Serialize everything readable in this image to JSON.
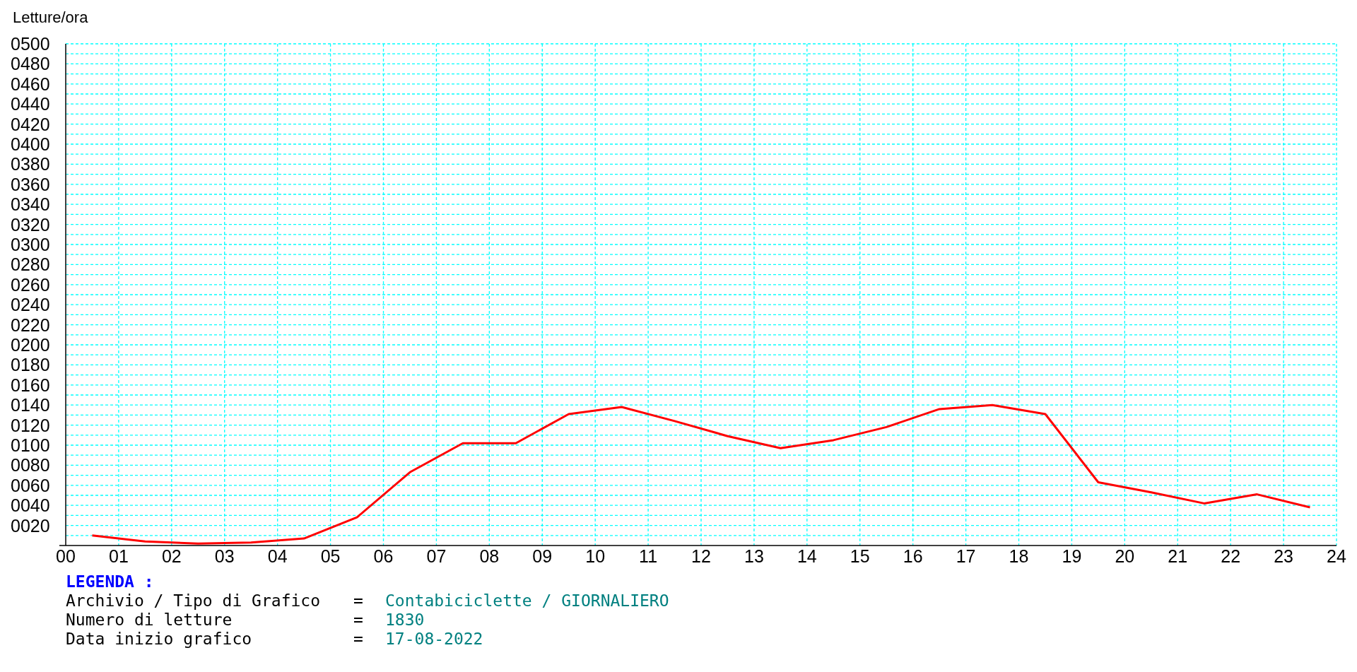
{
  "chart_data": {
    "type": "line",
    "ylabel": "Letture/ora",
    "x": [
      0.5,
      1.5,
      2.5,
      3.5,
      4.5,
      5.5,
      6.5,
      7.5,
      8.5,
      9.5,
      10.5,
      11.5,
      12.5,
      13.5,
      14.5,
      15.5,
      16.5,
      17.5,
      18.5,
      19.5,
      20.5,
      21.5,
      22.5,
      23.5
    ],
    "grid": true,
    "series": [
      {
        "color": "#ff0000",
        "values": [
          10,
          4,
          2,
          3,
          7,
          28,
          73,
          102,
          102,
          131,
          138,
          124,
          109,
          97,
          105,
          118,
          136,
          140,
          131,
          63,
          53,
          42,
          51,
          38
        ]
      }
    ],
    "xlim": [
      0,
      24
    ],
    "ylim": [
      0,
      500
    ],
    "xticks": [
      {
        "value": 0,
        "label": "00"
      },
      {
        "value": 1,
        "label": "01"
      },
      {
        "value": 2,
        "label": "02"
      },
      {
        "value": 3,
        "label": "03"
      },
      {
        "value": 4,
        "label": "04"
      },
      {
        "value": 5,
        "label": "05"
      },
      {
        "value": 6,
        "label": "06"
      },
      {
        "value": 7,
        "label": "07"
      },
      {
        "value": 8,
        "label": "08"
      },
      {
        "value": 9,
        "label": "09"
      },
      {
        "value": 10,
        "label": "10"
      },
      {
        "value": 11,
        "label": "11"
      },
      {
        "value": 12,
        "label": "12"
      },
      {
        "value": 13,
        "label": "13"
      },
      {
        "value": 14,
        "label": "14"
      },
      {
        "value": 15,
        "label": "15"
      },
      {
        "value": 16,
        "label": "16"
      },
      {
        "value": 17,
        "label": "17"
      },
      {
        "value": 18,
        "label": "18"
      },
      {
        "value": 19,
        "label": "19"
      },
      {
        "value": 20,
        "label": "20"
      },
      {
        "value": 21,
        "label": "21"
      },
      {
        "value": 22,
        "label": "22"
      },
      {
        "value": 23,
        "label": "23"
      },
      {
        "value": 24,
        "label": "24"
      }
    ],
    "yticks": [
      {
        "value": 20,
        "label": "0020"
      },
      {
        "value": 40,
        "label": "0040"
      },
      {
        "value": 60,
        "label": "0060"
      },
      {
        "value": 80,
        "label": "0080"
      },
      {
        "value": 100,
        "label": "0100"
      },
      {
        "value": 120,
        "label": "0120"
      },
      {
        "value": 140,
        "label": "0140"
      },
      {
        "value": 160,
        "label": "0160"
      },
      {
        "value": 180,
        "label": "0180"
      },
      {
        "value": 200,
        "label": "0200"
      },
      {
        "value": 220,
        "label": "0220"
      },
      {
        "value": 240,
        "label": "0240"
      },
      {
        "value": 260,
        "label": "0260"
      },
      {
        "value": 280,
        "label": "0280"
      },
      {
        "value": 300,
        "label": "0300"
      },
      {
        "value": 320,
        "label": "0320"
      },
      {
        "value": 340,
        "label": "0340"
      },
      {
        "value": 360,
        "label": "0360"
      },
      {
        "value": 380,
        "label": "0380"
      },
      {
        "value": 400,
        "label": "0400"
      },
      {
        "value": 420,
        "label": "0420"
      },
      {
        "value": 440,
        "label": "0440"
      },
      {
        "value": 460,
        "label": "0460"
      },
      {
        "value": 480,
        "label": "0480"
      },
      {
        "value": 500,
        "label": "0500"
      }
    ]
  },
  "legend": {
    "title": "LEGENDA :",
    "rows": [
      {
        "label": "Archivio / Tipo di Grafico",
        "sign": "=",
        "value": "Contabiciclette / GIORNALIERO"
      },
      {
        "label": "Numero di letture",
        "sign": "=",
        "value": "1830"
      },
      {
        "label": "Data inizio grafico",
        "sign": "=",
        "value": "17-08-2022"
      }
    ]
  }
}
